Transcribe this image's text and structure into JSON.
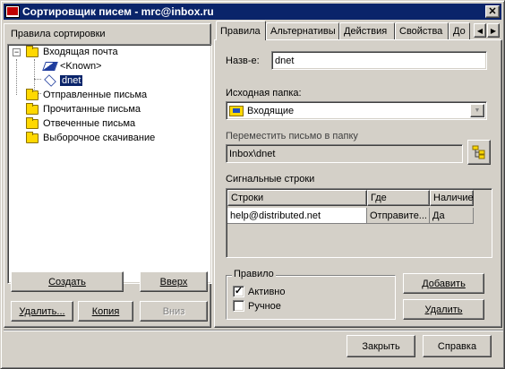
{
  "window": {
    "title": "Сортировщик писем - mrc@inbox.ru",
    "close_symbol": "✕"
  },
  "left": {
    "label": "Правила сортировки",
    "tree": {
      "root": {
        "label": "Входящая почта",
        "expander": "−"
      },
      "children": [
        {
          "label": "<Known>"
        },
        {
          "label": "dnet"
        }
      ],
      "folders": [
        {
          "label": "Отправленные письма"
        },
        {
          "label": "Прочитанные письма"
        },
        {
          "label": "Отвеченные письма"
        },
        {
          "label": "Выборочное скачивание"
        }
      ]
    },
    "buttons": {
      "create": "Создать",
      "up": "Вверх",
      "delete": "Удалить...",
      "copy": "Копия",
      "down": "Вниз"
    }
  },
  "tabs": [
    {
      "label": "Правила"
    },
    {
      "label": "Альтернативы"
    },
    {
      "label": "Действия"
    },
    {
      "label": "Свойства"
    },
    {
      "label": "До"
    }
  ],
  "tab_scroll": {
    "left": "◀",
    "right": "▶"
  },
  "rules_tab": {
    "name_label": "Назв-е:",
    "name_value": "dnet",
    "source_folder_label": "Исходная папка:",
    "source_folder_value": "Входящие",
    "move_label": "Переместить письмо в папку",
    "move_value": "Inbox\\dnet",
    "signal_label": "Сигнальные строки",
    "table": {
      "headers": [
        "Строки",
        "Где",
        "Наличие"
      ],
      "rows": [
        [
          "help@distributed.net",
          "Отправите...",
          "Да"
        ]
      ]
    },
    "rule_group": {
      "legend": "Правило",
      "active_label": "Активно",
      "active_checked": true,
      "manual_label": "Ручное",
      "manual_checked": false
    },
    "add_button": "Добавить",
    "delete_button": "Удалить"
  },
  "footer": {
    "close_button": "Закрыть",
    "help_button": "Справка"
  }
}
